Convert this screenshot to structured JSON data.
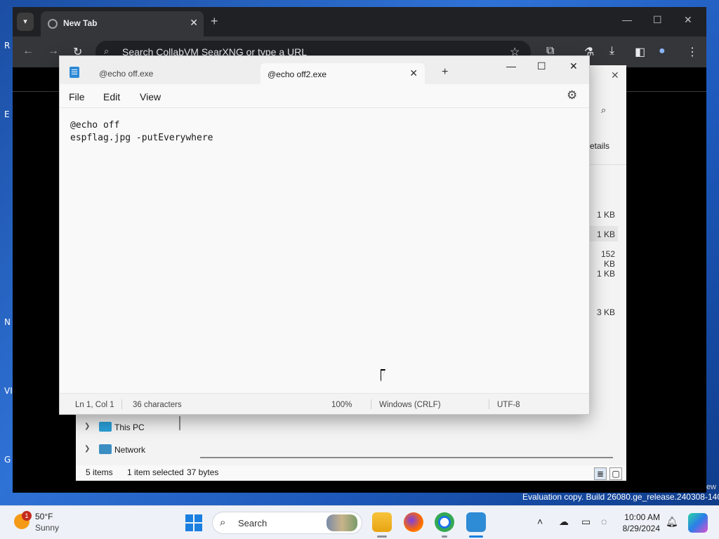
{
  "desktop": {
    "icon_letters": [
      "R",
      "E",
      "N",
      "VI",
      "G"
    ],
    "evaluation_text": "Evaluation copy. Build 26080.ge_release.240308-1400",
    "edge_text": "ew"
  },
  "chrome": {
    "tab_title": "New Tab",
    "omnibox_placeholder": "Search CollabVM SearXNG or type a URL"
  },
  "explorer": {
    "details_label": "etails",
    "sizes": [
      "1 KB",
      "1 KB",
      "152 KB",
      "1 KB",
      "3 KB"
    ],
    "nav_items": [
      {
        "label": "This PC"
      },
      {
        "label": "Network"
      }
    ],
    "status": {
      "items": "5 items",
      "selected": "1 item selected",
      "bytes": "37 bytes"
    }
  },
  "notepad": {
    "tabs": [
      {
        "label": "@echo off.exe",
        "active": false
      },
      {
        "label": "@echo off2.exe",
        "active": true
      }
    ],
    "menu": [
      "File",
      "Edit",
      "View"
    ],
    "content": "@echo off\nespflag.jpg -putEverywhere",
    "status": {
      "position": "Ln 1, Col 1",
      "characters": "36 characters",
      "zoom": "100%",
      "line_ending": "Windows (CRLF)",
      "encoding": "UTF-8"
    }
  },
  "taskbar": {
    "weather": {
      "temp": "50°F",
      "condition": "Sunny",
      "badge": "1"
    },
    "search_label": "Search",
    "time": "10:00 AM",
    "date": "8/29/2024"
  },
  "colors": {
    "accent": "#1a7fe0",
    "chrome_dark": "#202124",
    "chrome_toolbar": "#35363a",
    "notepad_bg": "#f9f9f9"
  }
}
